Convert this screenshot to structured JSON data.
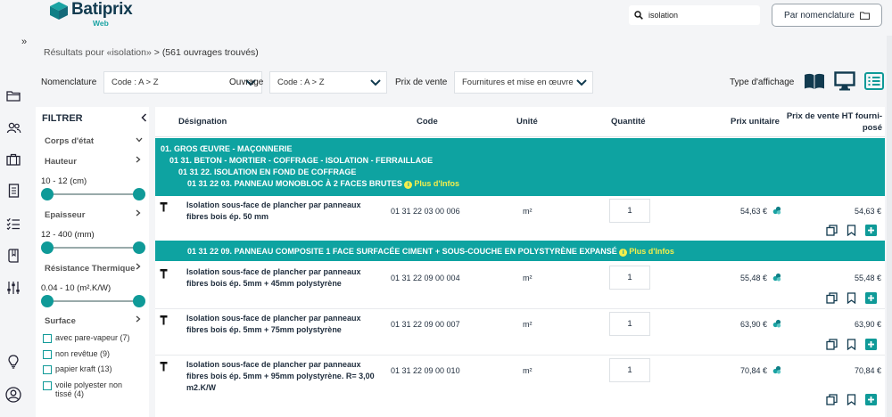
{
  "app": {
    "name": "Batiprix",
    "sub": "Web"
  },
  "search": {
    "value": "isolation"
  },
  "nomenclature_button": {
    "label": "Par nomenclature"
  },
  "breadcrumb": {
    "text": "Résultats pour «isolation»",
    "sep": ">",
    "count": "(561 ouvrages trouvés)"
  },
  "toolbar": {
    "nomenclature_label": "Nomenclature",
    "nomenclature_value": "Code : A > Z",
    "ouvrage_label": "Ouvrage",
    "ouvrage_value": "Code : A > Z",
    "prix_label": "Prix de vente",
    "prix_value": "Fournitures et mise en œuvre",
    "affichage_label": "Type d'affichage"
  },
  "filter": {
    "title": "FILTRER",
    "corps": "Corps d'état",
    "hauteur": "Hauteur",
    "hauteur_range": "10 - 12  (cm)",
    "epaisseur": "Epaisseur",
    "epaisseur_range": "12 - 400  (mm)",
    "resistance": "Résistance Thermique",
    "resistance_range": "0.04 - 10  (m².K/W)",
    "surface": "Surface",
    "surface_options": [
      "avec pare-vapeur (7)",
      "non revêtue (9)",
      "papier kraft (13)",
      "voile polyester non tissé (4)"
    ]
  },
  "table": {
    "headers": {
      "designation": "Désignation",
      "code": "Code",
      "unite": "Unité",
      "quantite": "Quantité",
      "prix_unitaire": "Prix unitaire",
      "prix_vente": "Prix de vente HT fourni-posé"
    },
    "group1": {
      "l1": "01. GROS ŒUVRE - MAÇONNERIE",
      "l2": "01 31. BETON - MORTIER - COFFRAGE - ISOLATION - FERRAILLAGE",
      "l3": "01 31 22. ISOLATION EN FOND DE COFFRAGE",
      "l4": "01 31 22 03. PANNEAU MONOBLOC À 2 FACES BRUTES",
      "info": "Plus d'Infos"
    },
    "group2": {
      "l1": "01 31 22 09. PANNEAU COMPOSITE 1 FACE SURFACÉE CIMENT + SOUS-COUCHE EN POLYSTYRÈNE EXPANSÉ",
      "info": "Plus d'Infos"
    },
    "rows": [
      {
        "designation": "Isolation sous-face de plancher par panneaux fibres bois ép. 50 mm",
        "code": "01 31 22 03 00 006",
        "unite": "m²",
        "quantite": "1",
        "prix_unitaire": "54,63 €",
        "prix_vente": "54,63 €"
      },
      {
        "designation": "Isolation sous-face de plancher par panneaux fibres bois ép. 5mm + 45mm polystyrène",
        "code": "01 31 22 09 00 004",
        "unite": "m²",
        "quantite": "1",
        "prix_unitaire": "55,48 €",
        "prix_vente": "55,48 €"
      },
      {
        "designation": "Isolation sous-face de plancher par panneaux fibres bois ép. 5mm + 75mm polystyrène",
        "code": "01 31 22 09 00 007",
        "unite": "m²",
        "quantite": "1",
        "prix_unitaire": "63,90 €",
        "prix_vente": "63,90 €"
      },
      {
        "designation": "Isolation sous-face de plancher par panneaux fibres bois ép. 5mm + 95mm polystyrène. R= 3,00 m2.K/W",
        "code": "01 31 22 09 00 010",
        "unite": "m²",
        "quantite": "1",
        "prix_unitaire": "70,84 €",
        "prix_vente": "70,84 €"
      }
    ]
  },
  "colors": {
    "teal": "#0ea3a1",
    "brand": "#113a4f",
    "info_yellow": "#f4ee4c"
  }
}
